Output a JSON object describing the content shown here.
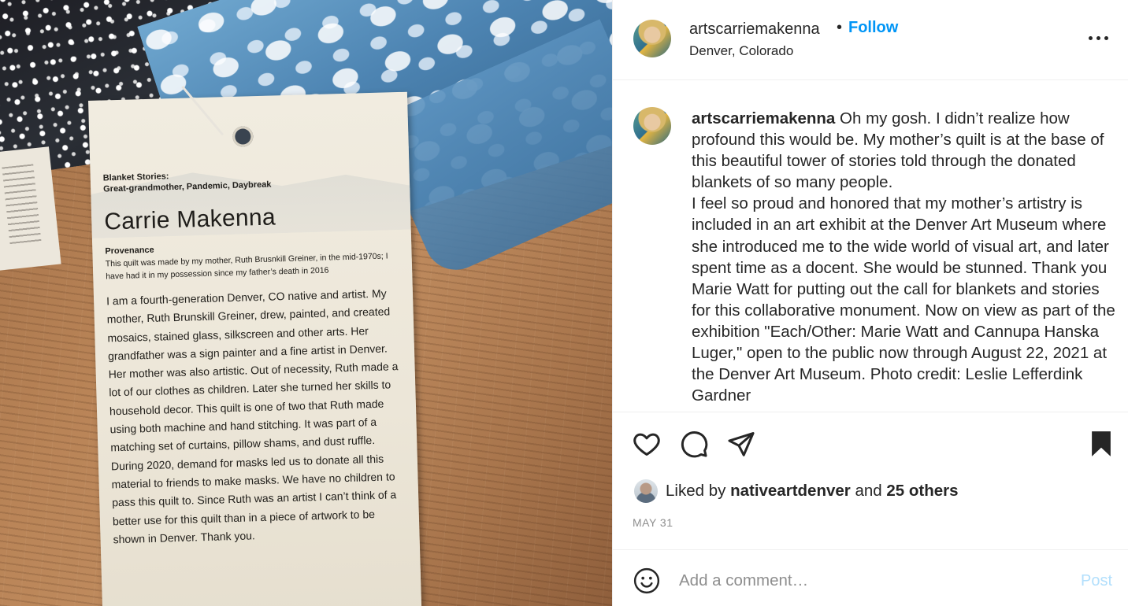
{
  "post": {
    "username": "artscarriemakenna",
    "separator": "•",
    "follow_label": "Follow",
    "location": "Denver, Colorado",
    "caption": " Oh my gosh. I didn’t realize how profound this would be. My mother’s quilt is at the base of this beautiful tower of stories told through the donated blankets of so many people.\nI feel so proud and honored that my mother’s artistry is included in an art exhibit at the Denver Art Museum where she introduced me to the wide world of visual art, and later spent time as a docent. She would be stunned. Thank you Marie Watt for putting out the call for blankets and stories for this collaborative monument. Now on view as part of the exhibition \"Each/Other: Marie Watt and Cannupa Hanska Luger,\" open to the public now through August 22, 2021 at the Denver Art Museum. Photo credit: Leslie Lefferdink Gardner",
    "liked_by_prefix": "Liked by",
    "liked_by_user": "nativeartdenver",
    "liked_by_and": "and",
    "liked_by_others": "25 others",
    "date": "MAY 31",
    "comment_placeholder": "Add a comment…",
    "post_label": "Post"
  },
  "photo_tag": {
    "series_line1": "Blanket Stories:",
    "series_line2": "Great-grandmother, Pandemic, Daybreak",
    "name": "Carrie Makenna",
    "provenance_heading": "Provenance",
    "provenance_text": "This quilt was made by my mother, Ruth Brusnkill Greiner, in the mid-1970s; I have had it in my possession since my father’s death in 2016",
    "body": "I am a fourth-generation Denver, CO native and artist. My mother, Ruth Brunskill Greiner, drew, painted, and created mosaics, stained glass, silkscreen and other arts. Her grandfather was a sign painter and a fine artist in Denver. Her mother was also artistic. Out of necessity, Ruth made a lot of our clothes as children. Later she turned her skills to household decor. This quilt is one of two that Ruth made using both machine and hand stitching. It was part of a matching set of curtains, pillow shams, and dust ruffle. During 2020, demand for masks led us to donate all this material to friends to make masks. We have no children to pass this quilt to. Since Ruth was an artist I can’t think of a better use for this quilt than in a piece of artwork to be shown in Denver. Thank you."
  },
  "icons": {
    "more": "more-options-icon",
    "like": "heart-icon",
    "comment": "comment-bubble-icon",
    "share": "paper-plane-icon",
    "save": "bookmark-icon",
    "emoji": "smiley-icon"
  },
  "colors": {
    "accent": "#0095f6",
    "post_disabled": "#b2dffc",
    "muted": "#8e8e8e",
    "text": "#262626",
    "divider": "#efefef"
  }
}
